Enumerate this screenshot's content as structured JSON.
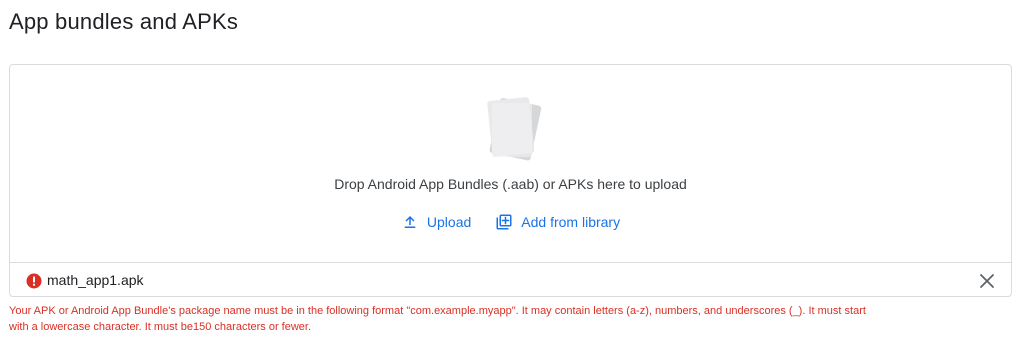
{
  "page": {
    "title": "App bundles and APKs"
  },
  "dropzone": {
    "instruction": "Drop Android App Bundles (.aab) or APKs here to upload",
    "upload_label": "Upload",
    "upload_icon": "upload-icon",
    "library_label": "Add from library",
    "library_icon": "library-add-icon"
  },
  "file": {
    "name": "math_app1.apk",
    "status_icon": "error-icon",
    "remove_icon": "close-icon"
  },
  "error": {
    "message_line1": "Your APK or Android App Bundle's package name must be in the following format \"com.example.myapp\". It may contain letters (a-z), numbers, and underscores (_). It must start",
    "message_line2": "with a lowercase character. It must be150 characters or fewer."
  },
  "colors": {
    "link": "#1a73e8",
    "error": "#d93025",
    "border": "#dadce0",
    "text": "#202124"
  }
}
